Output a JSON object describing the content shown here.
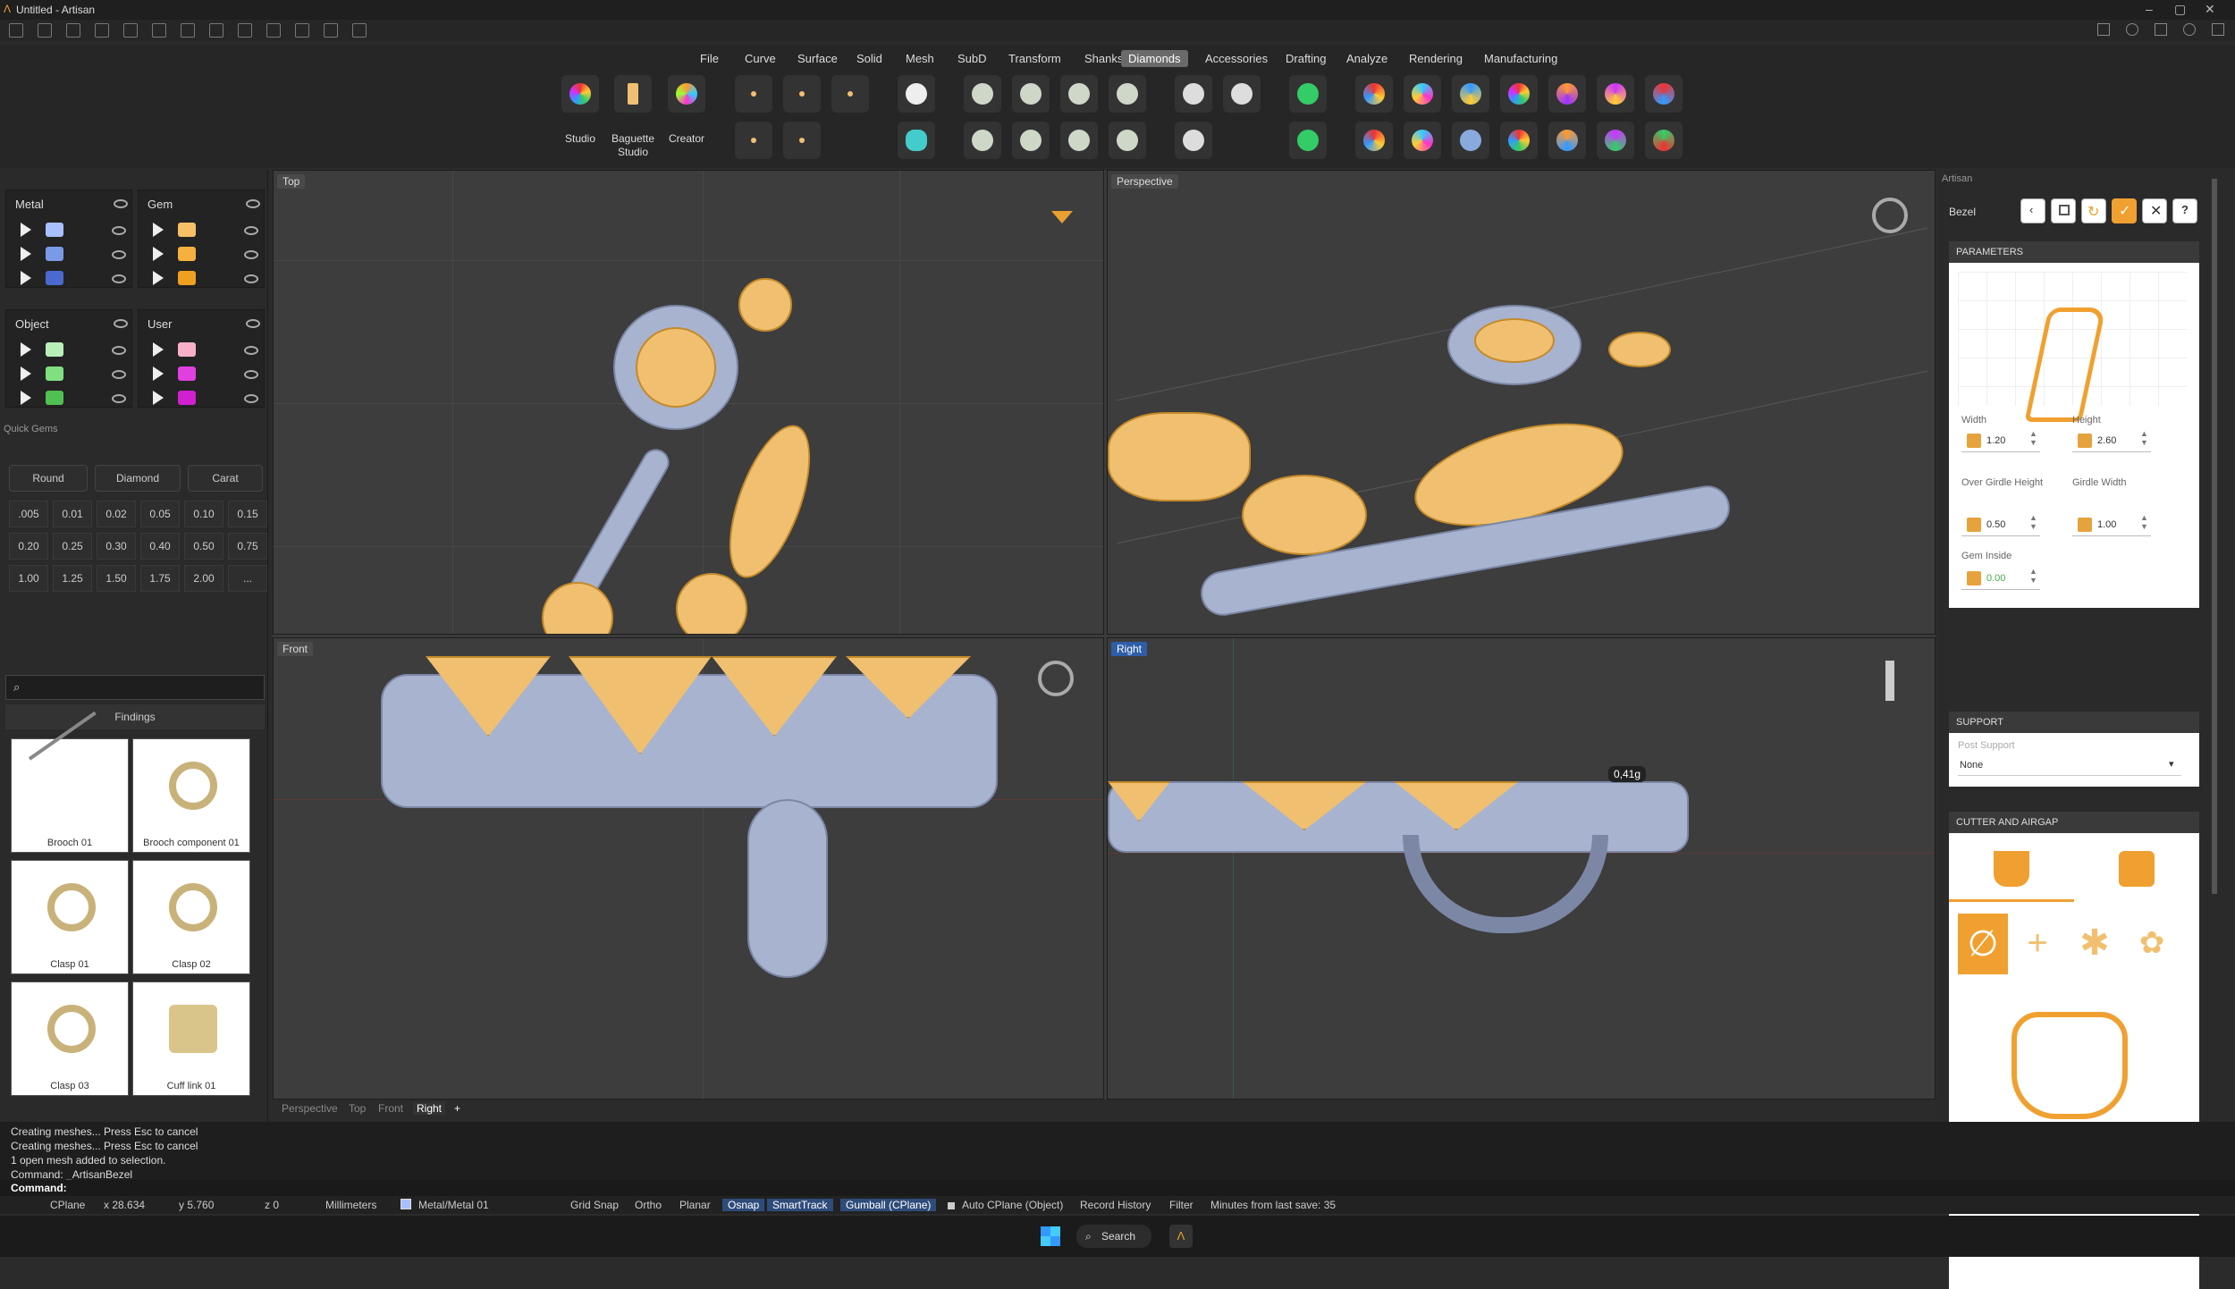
{
  "window": {
    "title": "Untitled - Artisan"
  },
  "menu": {
    "items": [
      "File",
      "Curve",
      "Surface",
      "Solid",
      "Mesh",
      "SubD",
      "Transform",
      "Shanks",
      "Diamonds",
      "Accessories",
      "Drafting",
      "Analyze",
      "Rendering",
      "Manufacturing"
    ],
    "active": "Diamonds"
  },
  "toolbar": {
    "studio": "Studio",
    "baguette": "Baguette\nStudio",
    "baguette1": "Baguette",
    "baguette2": "Studio",
    "creator": "Creator"
  },
  "layers": {
    "metal": "Metal",
    "gem": "Gem",
    "object": "Object",
    "user": "User"
  },
  "quick_gems": {
    "title": "Quick Gems",
    "round": "Round",
    "diamond": "Diamond",
    "carat": "Carat",
    "sizes": [
      ".005",
      "0.01",
      "0.02",
      "0.05",
      "0.10",
      "0.15",
      "0.20",
      "0.25",
      "0.30",
      "0.40",
      "0.50",
      "0.75",
      "1.00",
      "1.25",
      "1.50",
      "1.75",
      "2.00",
      "..."
    ]
  },
  "library": {
    "search_placeholder": "",
    "category": "Findings",
    "items": [
      "Brooch 01",
      "Brooch component 01",
      "Clasp 01",
      "Clasp 02",
      "Clasp 03",
      "Cuff link 01"
    ]
  },
  "viewports": {
    "top": "Top",
    "perspective": "Perspective",
    "front": "Front",
    "right": "Right",
    "weight_label": "0,41g",
    "tabs": [
      "Perspective",
      "Top",
      "Front",
      "Right"
    ]
  },
  "artisan": {
    "panel_title": "Artisan",
    "tool_name": "Bezel",
    "parameters_header": "PARAMETERS",
    "width_label": "Width",
    "width_value": "1.20",
    "height_label": "Height",
    "height_value": "2.60",
    "over_girdle_label": "Over Girdle Height",
    "over_girdle_value": "0.50",
    "girdle_width_label": "Girdle Width",
    "girdle_width_value": "1.00",
    "gem_inside_label": "Gem Inside",
    "gem_inside_value": "0.00",
    "support_header": "SUPPORT",
    "post_support_label": "Post Support",
    "post_support_value": "None",
    "cutter_header": "CUTTER AND AIRGAP"
  },
  "command": {
    "lines": [
      "Creating meshes... Press Esc to cancel",
      "Creating meshes... Press Esc to cancel",
      "1 open mesh added to selection.",
      "Command: _ArtisanBezel"
    ],
    "prompt": "Command:"
  },
  "status": {
    "cplane": "CPlane",
    "x": "x 28.634",
    "y": "y 5.760",
    "z": "z 0",
    "units": "Millimeters",
    "layer": "Metal/Metal 01",
    "grid_snap": "Grid Snap",
    "ortho": "Ortho",
    "planar": "Planar",
    "osnap": "Osnap",
    "smarttrack": "SmartTrack",
    "gumball": "Gumball (CPlane)",
    "auto_cplane": "Auto CPlane (Object)",
    "record_history": "Record History",
    "filter": "Filter",
    "minutes": "Minutes from last save: 35"
  },
  "taskbar": {
    "search": "Search"
  },
  "colors": {
    "accent": "#f0a030",
    "metal": "#a8b3cf",
    "gem": "#f0c070",
    "active_menu": "#6a6a6a"
  }
}
